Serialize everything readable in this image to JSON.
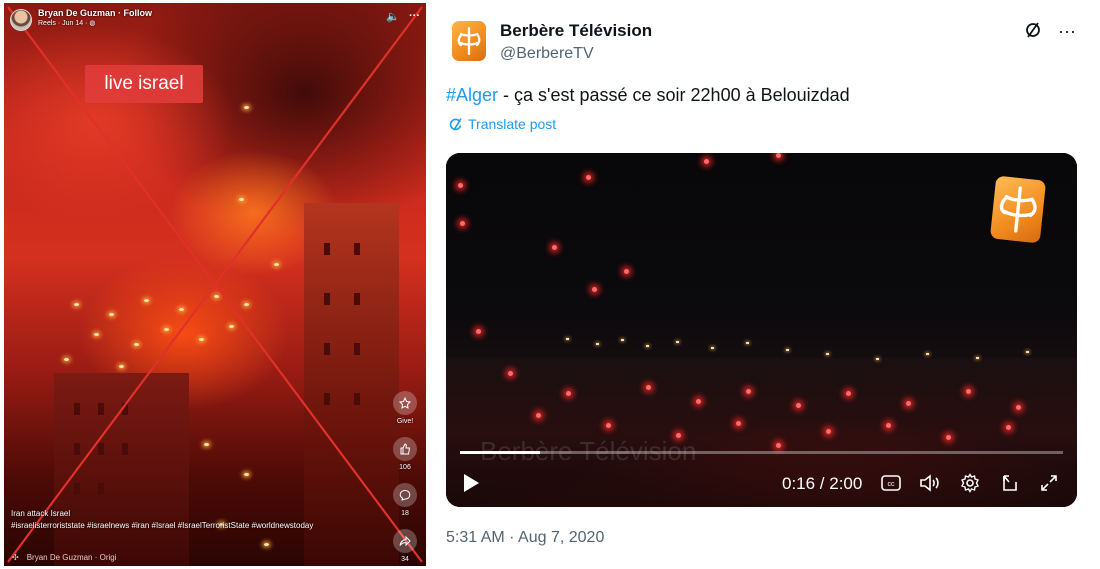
{
  "reel": {
    "author_name": "Bryan De Guzman",
    "follow_label": "Follow",
    "meta": "Reels · Jun 14 ·",
    "overlay_tag": "live israel",
    "actions": [
      {
        "icon": "gift-icon",
        "label": "Give!"
      },
      {
        "icon": "like-icon",
        "label": "106"
      },
      {
        "icon": "comment-icon",
        "label": "18"
      },
      {
        "icon": "share-icon",
        "label": "34"
      }
    ],
    "caption_title": "Iran attack Israel",
    "caption_tags": "#israelisterroriststate #israelnews #iran #Israel #IsraelTerroristState #worldnewstoday",
    "footer_audio": "Bryan De Guzman · Origi",
    "fact_check_mark_color": "#e0302a"
  },
  "tweet": {
    "account_name": "Berbère Télévision",
    "handle": "@BerbereTV",
    "hashtag": "#Alger",
    "text": " - ça s'est passé ce soir 22h00 à Belouizdad",
    "translate_label": "Translate post",
    "video": {
      "watermark": "Berbère Télévision",
      "time": "0:16 / 2:00",
      "progress": 0.133
    },
    "date": "5:31 AM · Aug 7, 2020",
    "link_color": "#1d9bf0"
  }
}
